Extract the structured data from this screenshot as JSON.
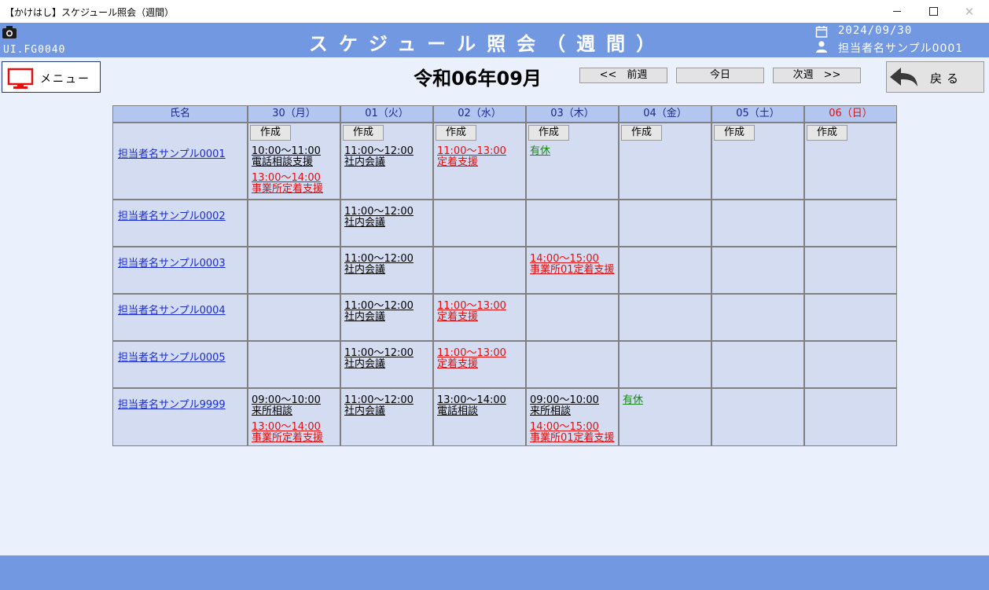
{
  "window": {
    "title": "【かけはし】スケジュール照会（週間）"
  },
  "header": {
    "screen_id": "UI.FG0040",
    "title": "スケジュール照会（週間）",
    "date": "2024/09/30",
    "user": "担当者名サンプル0001"
  },
  "toolbar": {
    "menu_label": "メニュー",
    "month_title": "令和06年09月",
    "prev_label": "<<　前週",
    "today_label": "今日",
    "next_label": "次週　>>",
    "back_label": "戻る"
  },
  "schedule": {
    "name_header": "氏名",
    "create_label": "作成",
    "days": [
      {
        "label": "30（月）",
        "color": "#1a2a8a"
      },
      {
        "label": "01（火）",
        "color": "#1a2a8a"
      },
      {
        "label": "02（水）",
        "color": "#1a2a8a"
      },
      {
        "label": "03（木）",
        "color": "#1a2a8a"
      },
      {
        "label": "04（金）",
        "color": "#1a2a8a"
      },
      {
        "label": "05（土）",
        "color": "#1a2a8a"
      },
      {
        "label": "06（日）",
        "color": "#d01818"
      }
    ],
    "rows": [
      {
        "name": "担当者名サンプル0001",
        "show_create": true,
        "cells": [
          [
            {
              "time": "10:00～11:00",
              "title": "電話相談支援",
              "color": "black"
            },
            {
              "time": "13:00～14:00",
              "title": "事業所定着支援",
              "color": "red"
            }
          ],
          [
            {
              "time": "11:00～12:00",
              "title": "社内会議",
              "color": "black"
            }
          ],
          [
            {
              "time": "11:00～13:00",
              "title": "定着支援",
              "color": "red"
            }
          ],
          [
            {
              "time": "",
              "title": "有休",
              "color": "green"
            }
          ],
          [],
          [],
          []
        ]
      },
      {
        "name": "担当者名サンプル0002",
        "show_create": false,
        "cells": [
          [],
          [
            {
              "time": "11:00～12:00",
              "title": "社内会議",
              "color": "black"
            }
          ],
          [],
          [],
          [],
          [],
          []
        ]
      },
      {
        "name": "担当者名サンプル0003",
        "show_create": false,
        "cells": [
          [],
          [
            {
              "time": "11:00～12:00",
              "title": "社内会議",
              "color": "black"
            }
          ],
          [],
          [
            {
              "time": "14:00～15:00",
              "title": "事業所01定着支援",
              "color": "red"
            }
          ],
          [],
          [],
          []
        ]
      },
      {
        "name": "担当者名サンプル0004",
        "show_create": false,
        "cells": [
          [],
          [
            {
              "time": "11:00～12:00",
              "title": "社内会議",
              "color": "black"
            }
          ],
          [
            {
              "time": "11:00～13:00",
              "title": "定着支援",
              "color": "red"
            }
          ],
          [],
          [],
          [],
          []
        ]
      },
      {
        "name": "担当者名サンプル0005",
        "show_create": false,
        "cells": [
          [],
          [
            {
              "time": "11:00～12:00",
              "title": "社内会議",
              "color": "black"
            }
          ],
          [
            {
              "time": "11:00～13:00",
              "title": "定着支援",
              "color": "red"
            }
          ],
          [],
          [],
          [],
          []
        ]
      },
      {
        "name": "担当者名サンプル9999",
        "show_create": false,
        "cells": [
          [
            {
              "time": "09:00～10:00",
              "title": "来所相談",
              "color": "black"
            },
            {
              "time": "13:00～14:00",
              "title": "事業所定着支援",
              "color": "red"
            }
          ],
          [
            {
              "time": "11:00～12:00",
              "title": "社内会議",
              "color": "black"
            }
          ],
          [
            {
              "time": "13:00～14:00",
              "title": "電話相談",
              "color": "black"
            }
          ],
          [
            {
              "time": "09:00～10:00",
              "title": "来所相談",
              "color": "black"
            },
            {
              "time": "14:00～15:00",
              "title": "事業所01定着支援",
              "color": "red"
            }
          ],
          [
            {
              "time": "",
              "title": "有休",
              "color": "green"
            }
          ],
          [],
          []
        ]
      }
    ]
  }
}
